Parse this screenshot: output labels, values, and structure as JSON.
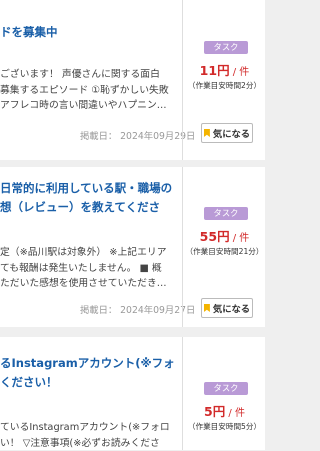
{
  "cards": [
    {
      "title_lines": [
        "ドを募集中"
      ],
      "desc_lines": [
        "ございます！ 声優さんに関する面白",
        "募集するエピソード ①恥ずかしい失敗",
        "アフレコ時の言い間違いやハプニング…"
      ],
      "date": "掲載日： 2024年09月29日",
      "tag": "タスク",
      "price": "11円",
      "price_unit": " / 件",
      "time": "（作業目安時間2分）",
      "fav_label": "気になる"
    },
    {
      "title_lines": [
        "日常的に利用している駅・職場の",
        "想（レビュー）を教えてくださ"
      ],
      "desc_lines": [
        "定（※品川駅は対象外） ※上記エリア",
        "ても報酬は発生いたしません。 ■ 概",
        "ただいた感想を使用させていただき…"
      ],
      "date": "掲載日： 2024年09月27日",
      "tag": "タスク",
      "price": "55円",
      "price_unit": " / 件",
      "time": "（作業目安時間21分）",
      "fav_label": "気になる"
    },
    {
      "title_lines": [
        "るInstagramアカウント(※フォ",
        "ください！"
      ],
      "desc_lines": [
        "ているInstagramアカウント(※フォロ",
        "い！ ▽注意事項(※必ずお読みくださ"
      ],
      "tag": "タスク",
      "price": "5円",
      "price_unit": " / 件",
      "time": "（作業目安時間5分）"
    }
  ]
}
